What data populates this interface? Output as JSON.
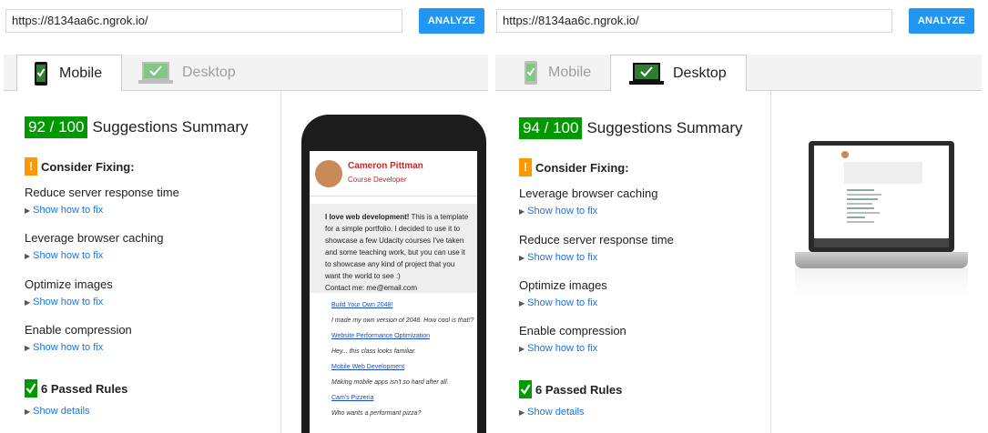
{
  "left": {
    "url": "https://8134aa6c.ngrok.io/",
    "analyze_label": "ANALYZE",
    "tabs": [
      {
        "label": "Mobile",
        "active": true
      },
      {
        "label": "Desktop",
        "active": false
      }
    ],
    "score": "92 / 100",
    "summary_label": "Suggestions Summary",
    "consider_label": "Consider Fixing:",
    "rules": [
      {
        "title": "Reduce server response time",
        "link": "Show how to fix"
      },
      {
        "title": "Leverage browser caching",
        "link": "Show how to fix"
      },
      {
        "title": "Optimize images",
        "link": "Show how to fix"
      },
      {
        "title": "Enable compression",
        "link": "Show how to fix"
      }
    ],
    "passed_label": "6 Passed Rules",
    "details_link": "Show details"
  },
  "right": {
    "url": "https://8134aa6c.ngrok.io/",
    "analyze_label": "ANALYZE",
    "tabs": [
      {
        "label": "Mobile",
        "active": false
      },
      {
        "label": "Desktop",
        "active": true
      }
    ],
    "score": "94 / 100",
    "summary_label": "Suggestions Summary",
    "consider_label": "Consider Fixing:",
    "rules": [
      {
        "title": "Leverage browser caching",
        "link": "Show how to fix"
      },
      {
        "title": "Reduce server response time",
        "link": "Show how to fix"
      },
      {
        "title": "Optimize images",
        "link": "Show how to fix"
      },
      {
        "title": "Enable compression",
        "link": "Show how to fix"
      }
    ],
    "passed_label": "6 Passed Rules",
    "details_link": "Show details"
  },
  "preview": {
    "name": "Cameron Pittman",
    "role": "Course Developer",
    "bio_strong": "I love web development!",
    "bio_rest": " This is a template for a simple portfolio. I decided to use it to showcase a few Udacity courses I've taken and some teaching work, but you can use it to showcase any kind of project that you want the world to see :)",
    "contact": "Contact me: me@email.com",
    "projects": [
      {
        "link": "Build Your Own 2048!",
        "desc": "I made my own version of 2048. How cool is that!?"
      },
      {
        "link": "Website Performance Optimization",
        "desc": "Hey... this class looks familiar."
      },
      {
        "link": "Mobile Web Development",
        "desc": "Making mobile apps isn't so hard after all."
      },
      {
        "link": "Cam's Pizzeria",
        "desc": "Who wants a performant pizza?"
      }
    ]
  },
  "colors": {
    "accent": "#2196f3",
    "score_green": "#009a00",
    "warning": "#ff9800",
    "link": "#1a73e8",
    "name_red": "#c62828"
  }
}
